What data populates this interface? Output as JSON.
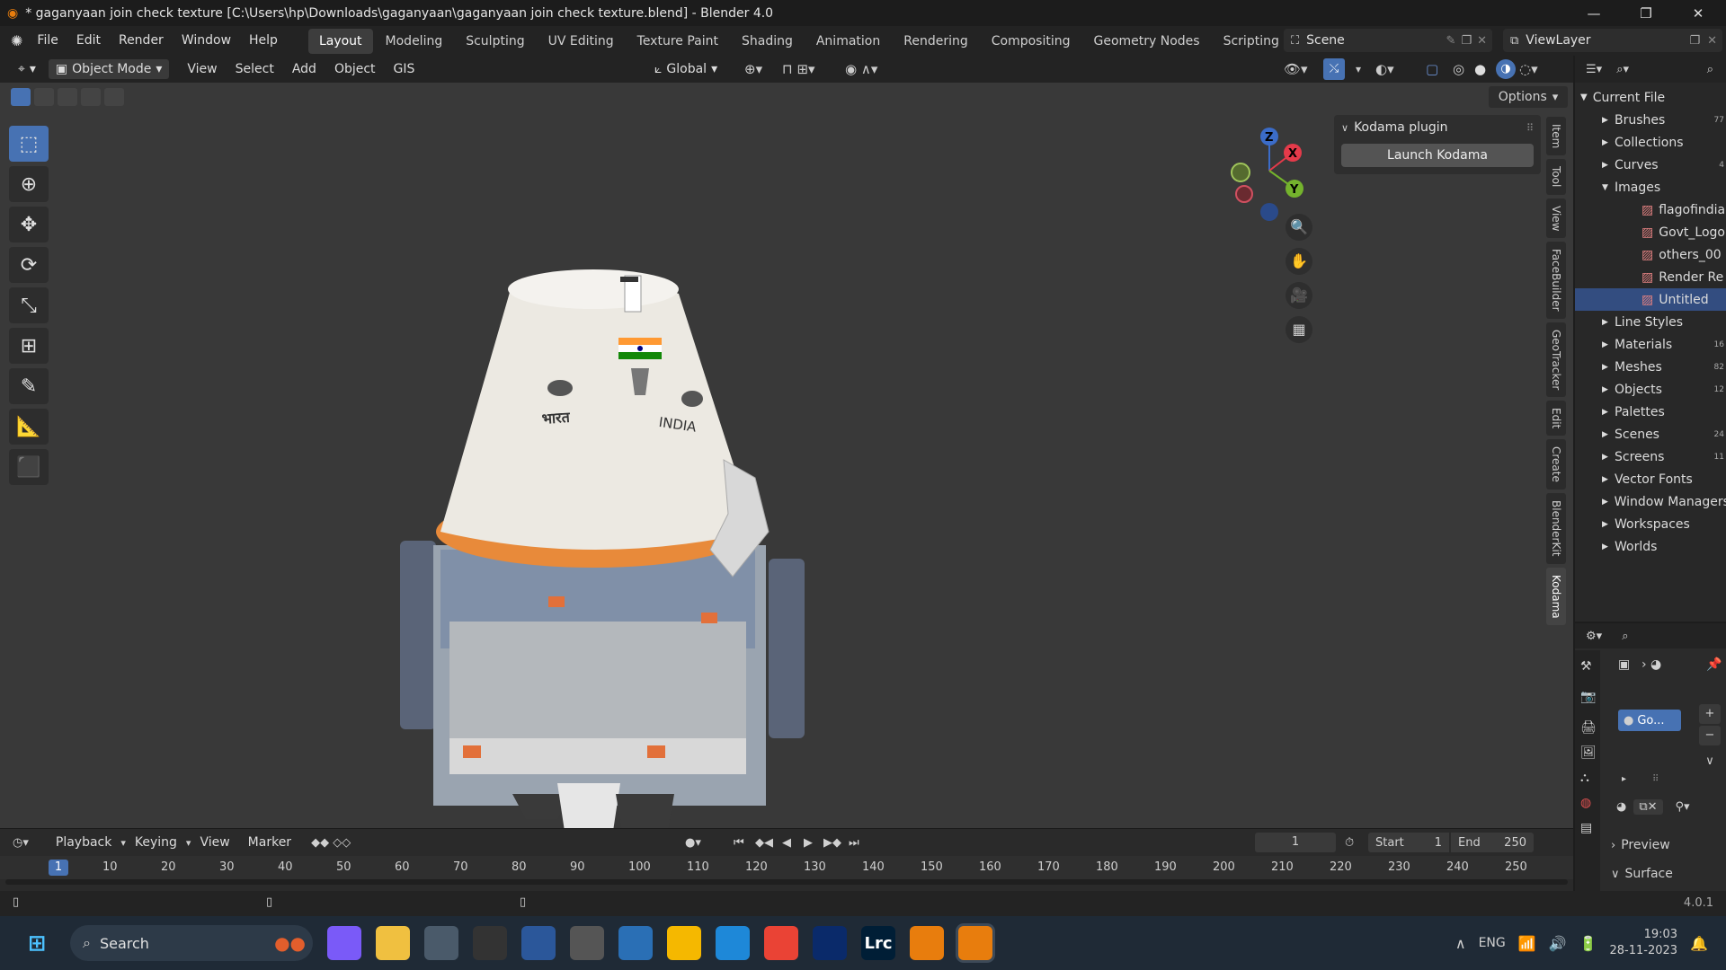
{
  "window": {
    "title": "* gaganyaan join check texture [C:\\Users\\hp\\Downloads\\gaganyaan\\gaganyaan join check texture.blend] - Blender 4.0",
    "controls": [
      "—",
      "❐",
      "✕"
    ]
  },
  "menu": {
    "items": [
      "File",
      "Edit",
      "Render",
      "Window",
      "Help"
    ],
    "workspaces": [
      "Layout",
      "Modeling",
      "Sculpting",
      "UV Editing",
      "Texture Paint",
      "Shading",
      "Animation",
      "Rendering",
      "Compositing",
      "Geometry Nodes",
      "Scripting"
    ],
    "add_workspace": "+",
    "active_workspace": "Layout",
    "scene": "Scene",
    "view_layer": "ViewLayer"
  },
  "viewport_header": {
    "mode": "Object Mode",
    "menus": [
      "View",
      "Select",
      "Add",
      "Object",
      "GIS"
    ],
    "orientation": "Global",
    "options": "Options"
  },
  "model": {
    "label_hindi": "भारत",
    "label_english": "INDIA"
  },
  "gizmo": {
    "x": "X",
    "y": "Y",
    "z": "Z"
  },
  "n_panel": {
    "tabs": [
      "Item",
      "Tool",
      "View",
      "FaceBuilder",
      "GeoTracker",
      "Edit",
      "Create",
      "BlenderKit",
      "Kodama"
    ],
    "active_tab": "Kodama",
    "panel_title": "Kodama plugin",
    "button": "Launch Kodama"
  },
  "outliner": {
    "root": "Current File",
    "items": [
      {
        "label": "Brushes",
        "badge": "77",
        "expanded": false,
        "child": false
      },
      {
        "label": "Collections",
        "badge": "",
        "expanded": false,
        "child": false
      },
      {
        "label": "Curves",
        "badge": "4",
        "expanded": false,
        "child": false
      },
      {
        "label": "Images",
        "badge": "",
        "expanded": true,
        "child": false
      },
      {
        "label": "flagofindia",
        "badge": "",
        "expanded": false,
        "child": true
      },
      {
        "label": "Govt_Logo",
        "badge": "",
        "expanded": false,
        "child": true
      },
      {
        "label": "others_00",
        "badge": "",
        "expanded": false,
        "child": true
      },
      {
        "label": "Render Re",
        "badge": "",
        "expanded": false,
        "child": true
      },
      {
        "label": "Untitled",
        "badge": "",
        "expanded": false,
        "child": true,
        "selected": true
      },
      {
        "label": "Line Styles",
        "badge": "",
        "expanded": false,
        "child": false
      },
      {
        "label": "Materials",
        "badge": "16",
        "expanded": false,
        "child": false
      },
      {
        "label": "Meshes",
        "badge": "82",
        "expanded": false,
        "child": false
      },
      {
        "label": "Objects",
        "badge": "12",
        "expanded": false,
        "child": false
      },
      {
        "label": "Palettes",
        "badge": "",
        "expanded": false,
        "child": false
      },
      {
        "label": "Scenes",
        "badge": "24",
        "expanded": false,
        "child": false
      },
      {
        "label": "Screens",
        "badge": "11",
        "expanded": false,
        "child": false
      },
      {
        "label": "Vector Fonts",
        "badge": "",
        "expanded": false,
        "child": false
      },
      {
        "label": "Window Managers",
        "badge": "",
        "expanded": false,
        "child": false
      },
      {
        "label": "Workspaces",
        "badge": "",
        "expanded": false,
        "child": false
      },
      {
        "label": "Worlds",
        "badge": "",
        "expanded": false,
        "child": false
      }
    ]
  },
  "properties": {
    "material_slot": "Go...",
    "sections": [
      "Preview",
      "Surface"
    ]
  },
  "timeline": {
    "menus": [
      "Playback",
      "Keying",
      "View",
      "Marker"
    ],
    "current_frame": "1",
    "start_label": "Start",
    "start": "1",
    "end_label": "End",
    "end": "250",
    "ruler": [
      "10",
      "20",
      "30",
      "40",
      "50",
      "60",
      "70",
      "80",
      "90",
      "100",
      "110",
      "120",
      "130",
      "140",
      "150",
      "160",
      "170",
      "180",
      "190",
      "200",
      "210",
      "220",
      "230",
      "240",
      "250"
    ],
    "cursor": "1"
  },
  "status": {
    "version": "4.0.1"
  },
  "taskbar": {
    "search": "Search",
    "apps": [
      "Copilot",
      "Explorer",
      "Calculator",
      "OBS",
      "Word",
      "Game",
      "Photos",
      "Notes",
      "Edge",
      "Chrome",
      "Ubisoft",
      "Lrc",
      "Blender",
      "Blender"
    ],
    "lang": "ENG",
    "time": "19:03",
    "date": "28-11-2023"
  },
  "colors": {
    "accent": "#4772b3",
    "selection": "#334d80",
    "viewport_bg": "#393939",
    "capsule_white": "#ece9e2",
    "heat_shield": "#e88a3a"
  }
}
